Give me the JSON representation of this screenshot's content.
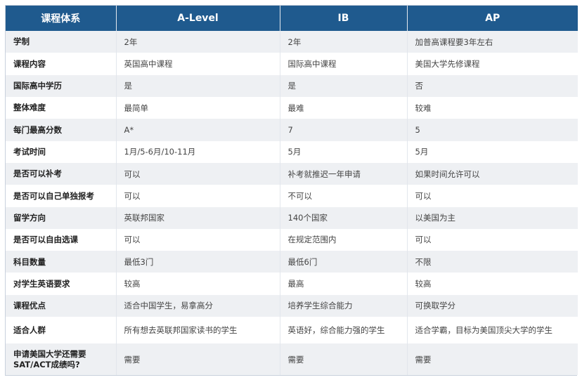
{
  "header": [
    "课程体系",
    "A-Level",
    "IB",
    "AP"
  ],
  "rows": [
    [
      "学制",
      "2年",
      "2年",
      "加普高课程要3年左右"
    ],
    [
      "课程内容",
      "英国高中课程",
      "国际高中课程",
      "美国大学先修课程"
    ],
    [
      "国际高中学历",
      "是",
      "是",
      "否"
    ],
    [
      "整体难度",
      "最简单",
      "最难",
      "较难"
    ],
    [
      "每门最高分数",
      "A*",
      "7",
      "5"
    ],
    [
      "考试时间",
      "1月/5-6月/10-11月",
      "5月",
      "5月"
    ],
    [
      "是否可以补考",
      "可以",
      "补考就推迟一年申请",
      "如果时间允许可以"
    ],
    [
      "是否可以自己单独报考",
      "可以",
      "不可以",
      "可以"
    ],
    [
      "留学方向",
      "英联邦国家",
      "140个国家",
      "以美国为主"
    ],
    [
      "是否可以自由选课",
      "可以",
      "在规定范围内",
      "可以"
    ],
    [
      "科目数量",
      "最低3门",
      "最低6门",
      "不限"
    ],
    [
      "对学生英语要求",
      "较高",
      "最高",
      "较高"
    ],
    [
      "课程优点",
      "适合中国学生，易拿高分",
      "培养学生综合能力",
      "可换取学分"
    ],
    [
      "适合人群",
      "所有想去英联邦国家读书的学生",
      "英语好，综合能力强的学生",
      "适合学霸，目标为美国顶尖大学的学生"
    ],
    [
      "申请美国大学还需要SAT/ACT成绩吗?",
      "需要",
      "需要",
      "需要"
    ]
  ]
}
